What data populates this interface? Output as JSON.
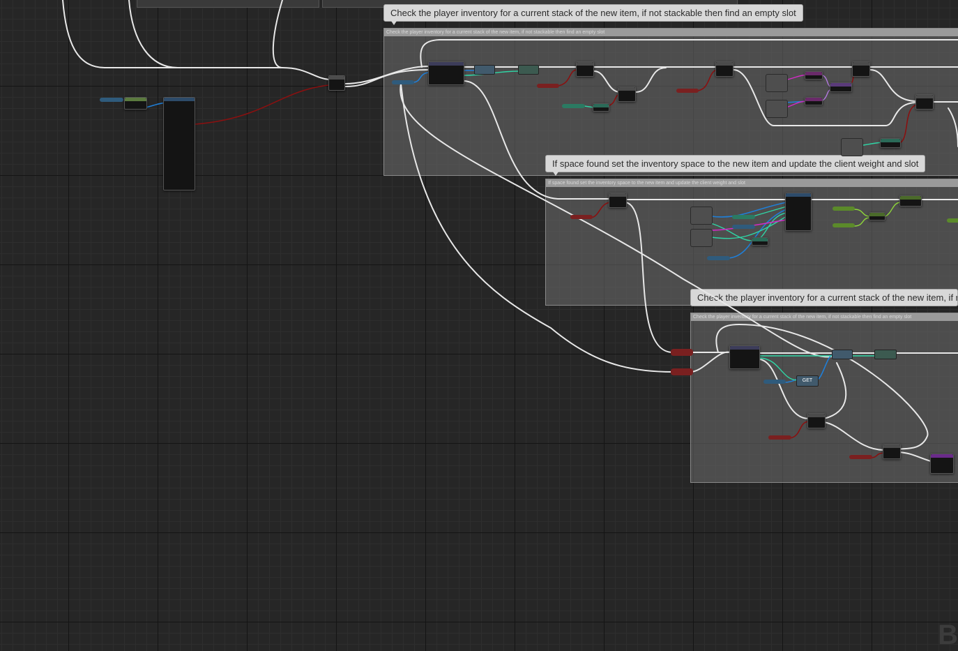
{
  "graph": {
    "comments": [
      {
        "bubble": "Check the player inventory for a current stack of the new item, if not stackable then find an empty slot",
        "header": "Check the player inventory for a current stack of the new item, if not stackable then find an empty slot"
      },
      {
        "bubble": "If space found set the inventory space to the new item and update the client weight and slot",
        "header": "If space found set the inventory space to the new item and update the client weight and slot"
      },
      {
        "bubble": "Check the player inventory for a current stack of the new item, if n",
        "header": "Check the player inventory for a current stack of the new item, if not stackable then find an empty slot"
      }
    ],
    "get_label": "GET",
    "watermark": "B"
  },
  "colors": {
    "exec_wire": "#e8e8e8",
    "bool_wire": "#8a1010",
    "object_wire": "#1f7fd8",
    "int_wire": "#2fd6a6",
    "float_wire": "#8ed53a",
    "struct_wire": "#d42ac8",
    "byte_wire": "#b47ae0"
  }
}
